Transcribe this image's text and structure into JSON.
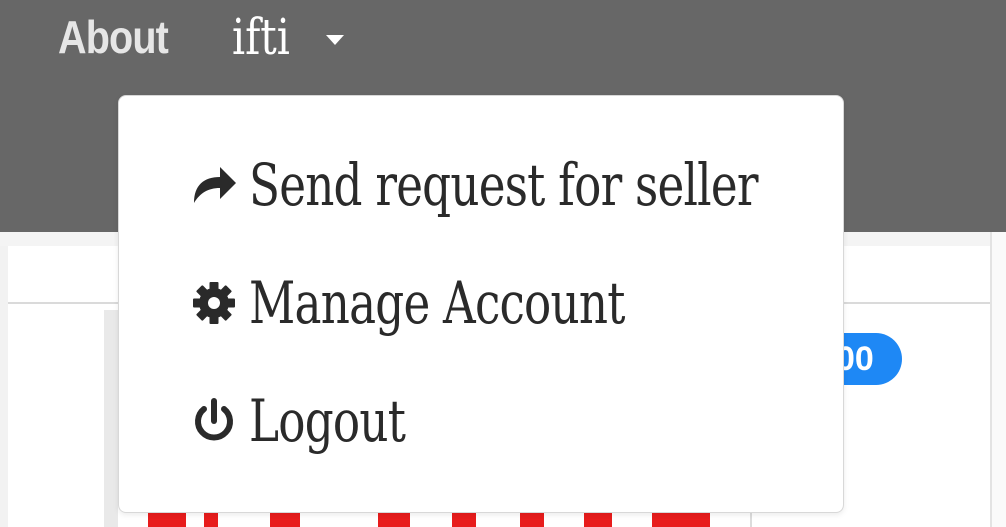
{
  "navbar": {
    "about_label": "About",
    "user_name": "ifti"
  },
  "dropdown": {
    "items": [
      {
        "label": "Send request for seller",
        "icon": "share-icon"
      },
      {
        "label": "Manage Account",
        "icon": "gear-icon"
      },
      {
        "label": "Logout",
        "icon": "power-icon"
      }
    ]
  },
  "background": {
    "badge_text": "00"
  },
  "colors": {
    "navbar_bg": "#676767",
    "badge_bg": "#1e88f5",
    "accent_red": "#e81c1c"
  }
}
